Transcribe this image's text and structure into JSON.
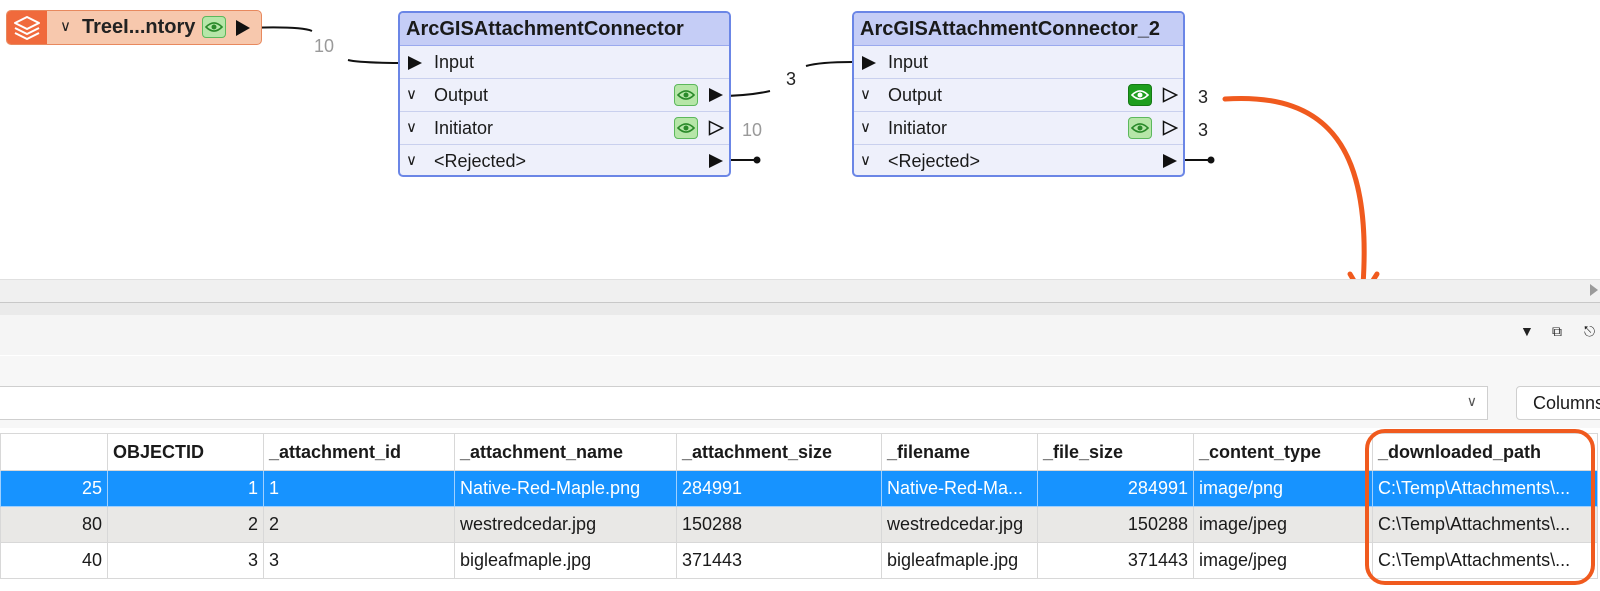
{
  "workspace": {
    "reader": {
      "title": "TreeI...ntory",
      "icon": "layers-icon"
    },
    "transformers": [
      {
        "title": "ArcGISAttachmentConnector",
        "ports": {
          "input": "Input",
          "output": "Output",
          "initiator": "Initiator",
          "rejected": "<Rejected>"
        }
      },
      {
        "title": "ArcGISAttachmentConnector_2",
        "ports": {
          "input": "Input",
          "output": "Output",
          "initiator": "Initiator",
          "rejected": "<Rejected>"
        }
      }
    ],
    "counts": {
      "reader_to_connector": "10",
      "connector_output": "3",
      "connector_initiator": "10",
      "connector2_output": "3",
      "connector2_initiator": "3"
    },
    "annotation_color": "#f05a1e"
  },
  "inspector": {
    "columns_button": "Columns",
    "table": {
      "headers": [
        "",
        "OBJECTID",
        "_attachment_id",
        "_attachment_name",
        "_attachment_size",
        "_filename",
        "_file_size",
        "_content_type",
        "_downloaded_path"
      ],
      "rows": [
        [
          "25",
          "1",
          "1",
          "Native-Red-Maple.png",
          "284991",
          "Native-Red-Ma...",
          "284991",
          "image/png",
          "C:\\Temp\\Attachments\\..."
        ],
        [
          "80",
          "2",
          "2",
          "westredcedar.jpg",
          "150288",
          "westredcedar.jpg",
          "150288",
          "image/jpeg",
          "C:\\Temp\\Attachments\\..."
        ],
        [
          "40",
          "3",
          "3",
          "bigleafmaple.jpg",
          "371443",
          "bigleafmaple.jpg",
          "371443",
          "image/jpeg",
          "C:\\Temp\\Attachments\\..."
        ]
      ],
      "selected_row": 0
    }
  },
  "colors": {
    "selection": "#1793ff",
    "node_border": "#6b86e6",
    "node_header": "#c5cdf6",
    "reader_fill": "#f7c8ad"
  }
}
